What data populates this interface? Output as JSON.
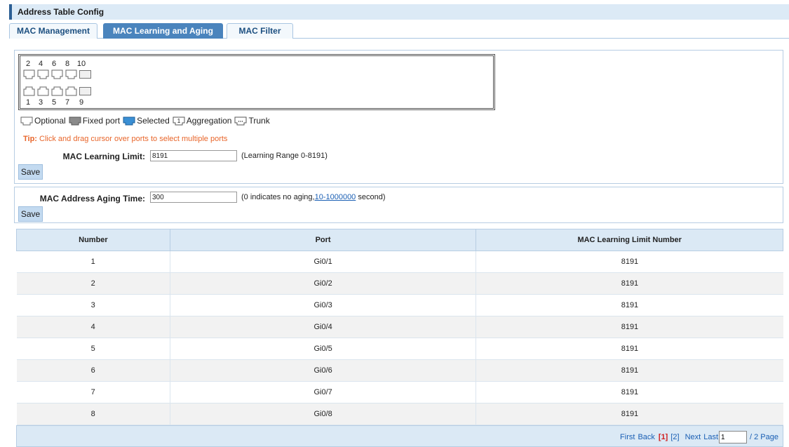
{
  "header": {
    "title": "Address Table Config"
  },
  "tabs": [
    {
      "label": "MAC Management"
    },
    {
      "label": "MAC Learning and Aging"
    },
    {
      "label": "MAC Filter"
    }
  ],
  "ports": {
    "top_labels": [
      "2",
      "4",
      "6",
      "8",
      "10"
    ],
    "bottom_labels": [
      "1",
      "3",
      "5",
      "7",
      "9"
    ]
  },
  "legend": {
    "optional": "Optional",
    "fixed": "Fixed port",
    "selected": "Selected",
    "aggregation": "Aggregation",
    "aggregation_badge": "1",
    "trunk": "Trunk"
  },
  "tip": {
    "prefix": "Tip:",
    "text": " Click and drag cursor over ports to select multiple ports"
  },
  "learning": {
    "label": "MAC Learning Limit:",
    "value": "8191",
    "hint": "(Learning Range 0-8191)",
    "save": "Save"
  },
  "aging": {
    "label": "MAC Address Aging Time:",
    "value": "300",
    "hint_prefix": "(0 indicates no aging,",
    "hint_link": "10-1000000",
    "hint_suffix": " second)",
    "save": "Save"
  },
  "table": {
    "headers": [
      "Number",
      "Port",
      "MAC Learning Limit Number"
    ],
    "rows": [
      [
        "1",
        "Gi0/1",
        "8191"
      ],
      [
        "2",
        "Gi0/2",
        "8191"
      ],
      [
        "3",
        "Gi0/3",
        "8191"
      ],
      [
        "4",
        "Gi0/4",
        "8191"
      ],
      [
        "5",
        "Gi0/5",
        "8191"
      ],
      [
        "6",
        "Gi0/6",
        "8191"
      ],
      [
        "7",
        "Gi0/7",
        "8191"
      ],
      [
        "8",
        "Gi0/8",
        "8191"
      ]
    ]
  },
  "pager": {
    "first": "First",
    "back": "Back",
    "current": "[1]",
    "page2": "[2]",
    "next": "Next",
    "last": "Last",
    "input_value": "1",
    "total": "/ 2 Page"
  },
  "colors": {
    "accent": "#4a84bd",
    "header_bg": "#dbe9f5",
    "tip": "#e8652a",
    "link": "#1a5fb4"
  }
}
